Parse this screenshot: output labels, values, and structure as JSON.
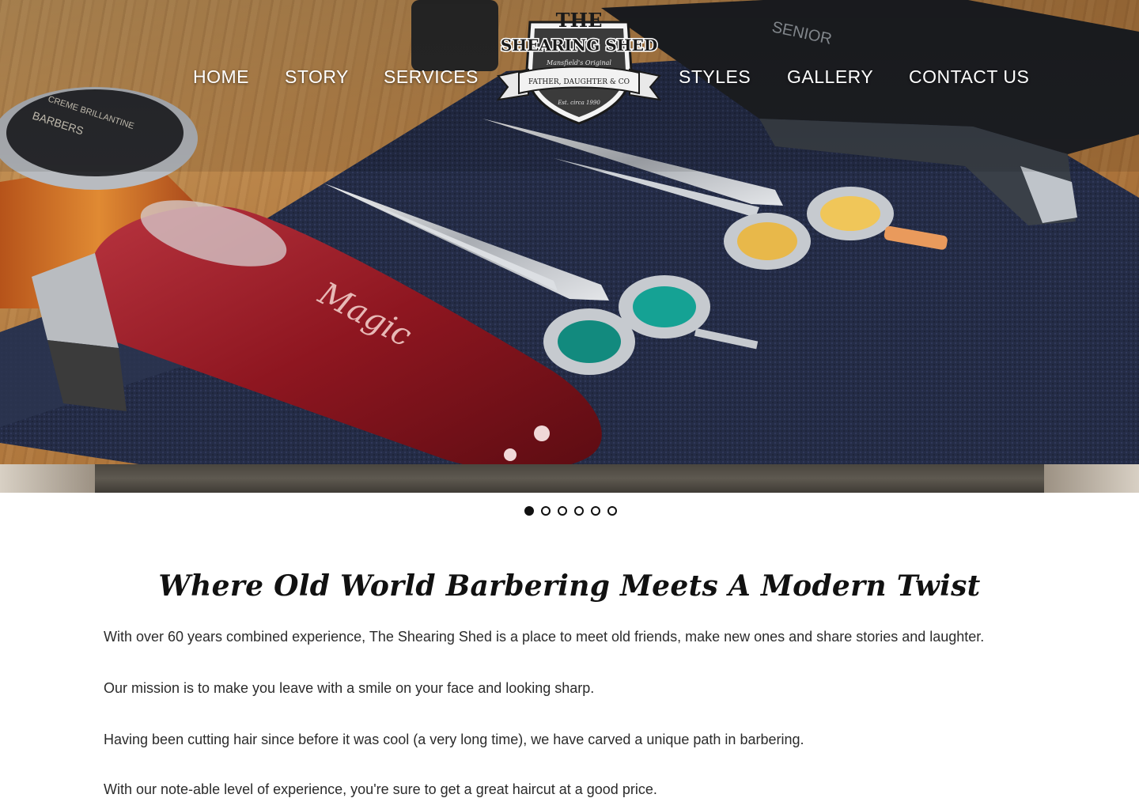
{
  "nav": {
    "left": [
      "HOME",
      "STORY",
      "SERVICES"
    ],
    "right": [
      "STYLES",
      "GALLERY",
      "CONTACT US"
    ]
  },
  "logo": {
    "line1": "THE",
    "line2": "SHEARING SHED",
    "line3": "Mansfield's Original",
    "line4": "FATHER, DAUGHTER & CO",
    "line5": "Est. circa 1990"
  },
  "hero": {
    "clipper_brand": "Magic",
    "jar_label_1": "BARBERS",
    "jar_label_2": "CREME BRILLANTINE",
    "case_label": "SENIOR",
    "slides_total": 6,
    "active_slide": 1
  },
  "content": {
    "tagline": "Where Old World Barbering Meets A Modern Twist",
    "paragraphs": [
      "With over 60 years combined experience, The Shearing Shed is a place to meet old friends, make new ones and share stories and laughter.",
      "Our mission is to make you leave with a smile on your face and looking sharp.",
      "Having been cutting hair since before it was cool (a very long time), we have carved a unique path in barbering.",
      "With our note-able level of experience, you're sure to get a great haircut at a good price."
    ]
  },
  "colors": {
    "nav_text": "#ffffff",
    "body_text": "#2b2b2b",
    "towel": "#232b44",
    "clipper": "#8e1620",
    "wood": "#b27a3f"
  }
}
